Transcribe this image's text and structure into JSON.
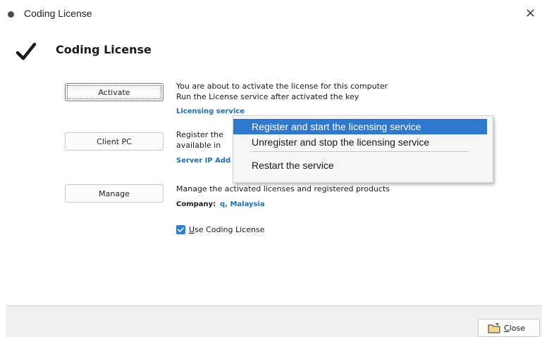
{
  "window": {
    "title": "Coding License",
    "close_symbol": "×"
  },
  "header": {
    "title": "Coding License"
  },
  "buttons": {
    "activate": "Activate",
    "client_pc": "Client PC",
    "manage": "Manage"
  },
  "activate_section": {
    "line1": "You are about to activate the license for this computer",
    "line2": "Run the License service after activated the key",
    "link": "Licensing service"
  },
  "client_section": {
    "line1": "Register the",
    "line2": "available in",
    "link": "Server IP Add"
  },
  "manage_section": {
    "line1": "Manage the activated licenses and registered products",
    "company_label": "Company:",
    "company_value": "q, Malaysia"
  },
  "checkbox": {
    "label_mnemonic": "U",
    "label_rest": "se Coding License",
    "checked": true
  },
  "context_menu": {
    "items": [
      "Register and start the licensing service",
      "Unregister and stop the licensing service",
      "Restart the service"
    ],
    "highlighted_index": 0
  },
  "footer": {
    "close_mnemonic": "C",
    "close_rest": "lose"
  },
  "colors": {
    "link": "#1f6fb6",
    "highlight": "#2f78cf",
    "checkbox": "#2d7fd3"
  },
  "icons": {
    "header": "checkmark-icon",
    "close_button": "folder-icon",
    "window": "window-dot-icon"
  }
}
